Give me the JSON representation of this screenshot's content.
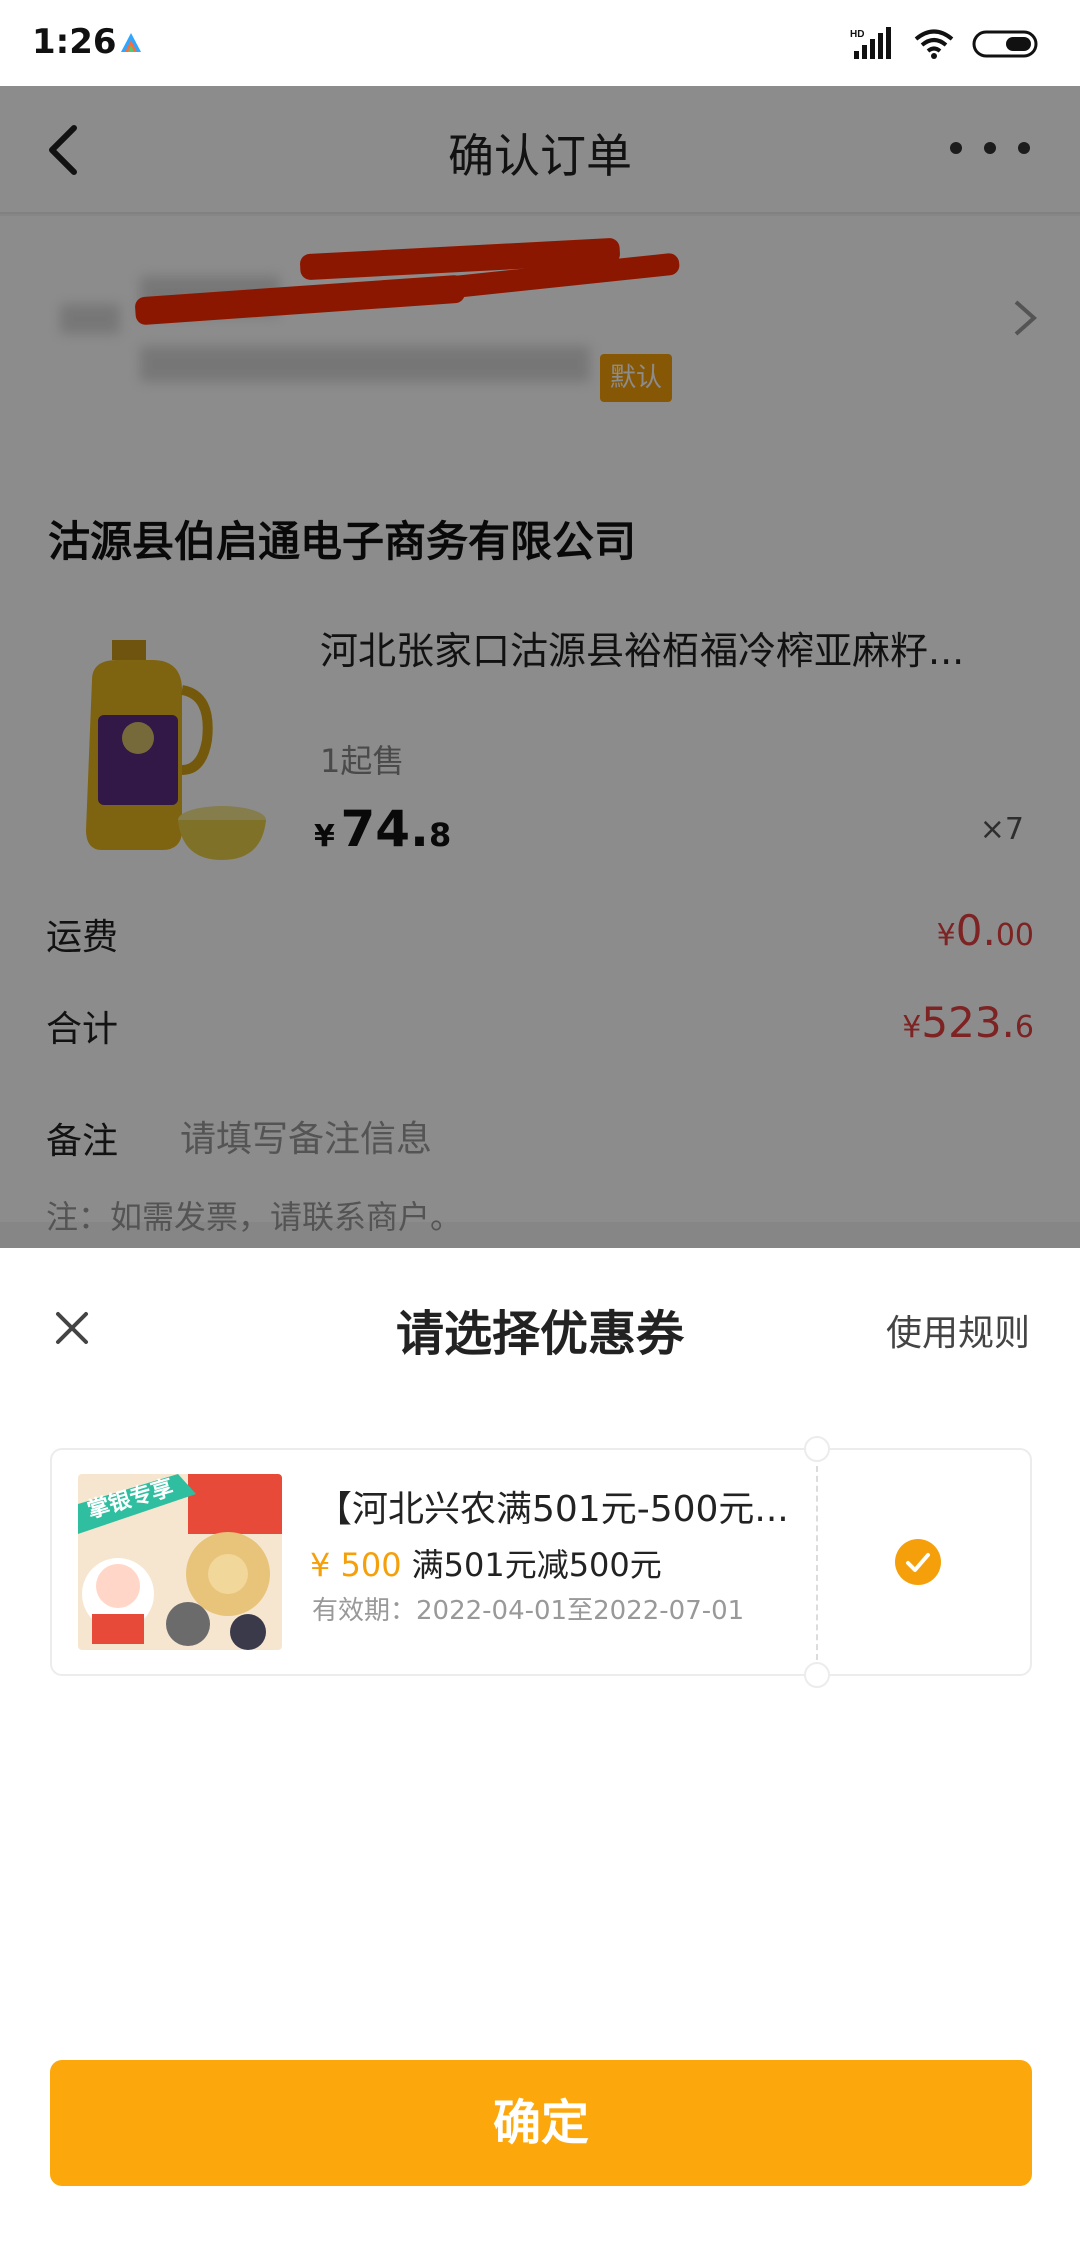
{
  "status_bar": {
    "time": "1:26",
    "network": "HD"
  },
  "navbar": {
    "title": "确认订单"
  },
  "address": {
    "default_tag": "默认"
  },
  "shop": {
    "name": "沽源县伯启通电子商务有限公司",
    "product": {
      "title": "河北张家口沽源县裕栢福冷榨亚麻籽...",
      "min_sale": "1起售",
      "price_symbol": "¥",
      "price_int": "74.",
      "price_dec": "8",
      "quantity": "×7"
    },
    "shipping": {
      "label": "运费",
      "symbol": "¥",
      "int": "0.",
      "dec": "00"
    },
    "total": {
      "label": "合计",
      "symbol": "¥",
      "int": "523.",
      "dec": "6"
    },
    "remark": {
      "label": "备注",
      "placeholder": "请填写备注信息"
    },
    "note": "注：如需发票，请联系商户。"
  },
  "coupon_sheet": {
    "title": "请选择优惠券",
    "rules_label": "使用规则",
    "coupons": [
      {
        "title": "【河北兴农满501元-500元...",
        "amount": "¥ 500",
        "condition": "满501元减500元",
        "validity": "有效期：2022-04-01至2022-07-01",
        "badge": "掌银专享",
        "selected": true
      }
    ],
    "confirm_label": "确定"
  },
  "colors": {
    "accent": "#fca80c",
    "price_red": "#e34040",
    "coupon_orange": "#f5a00b"
  }
}
